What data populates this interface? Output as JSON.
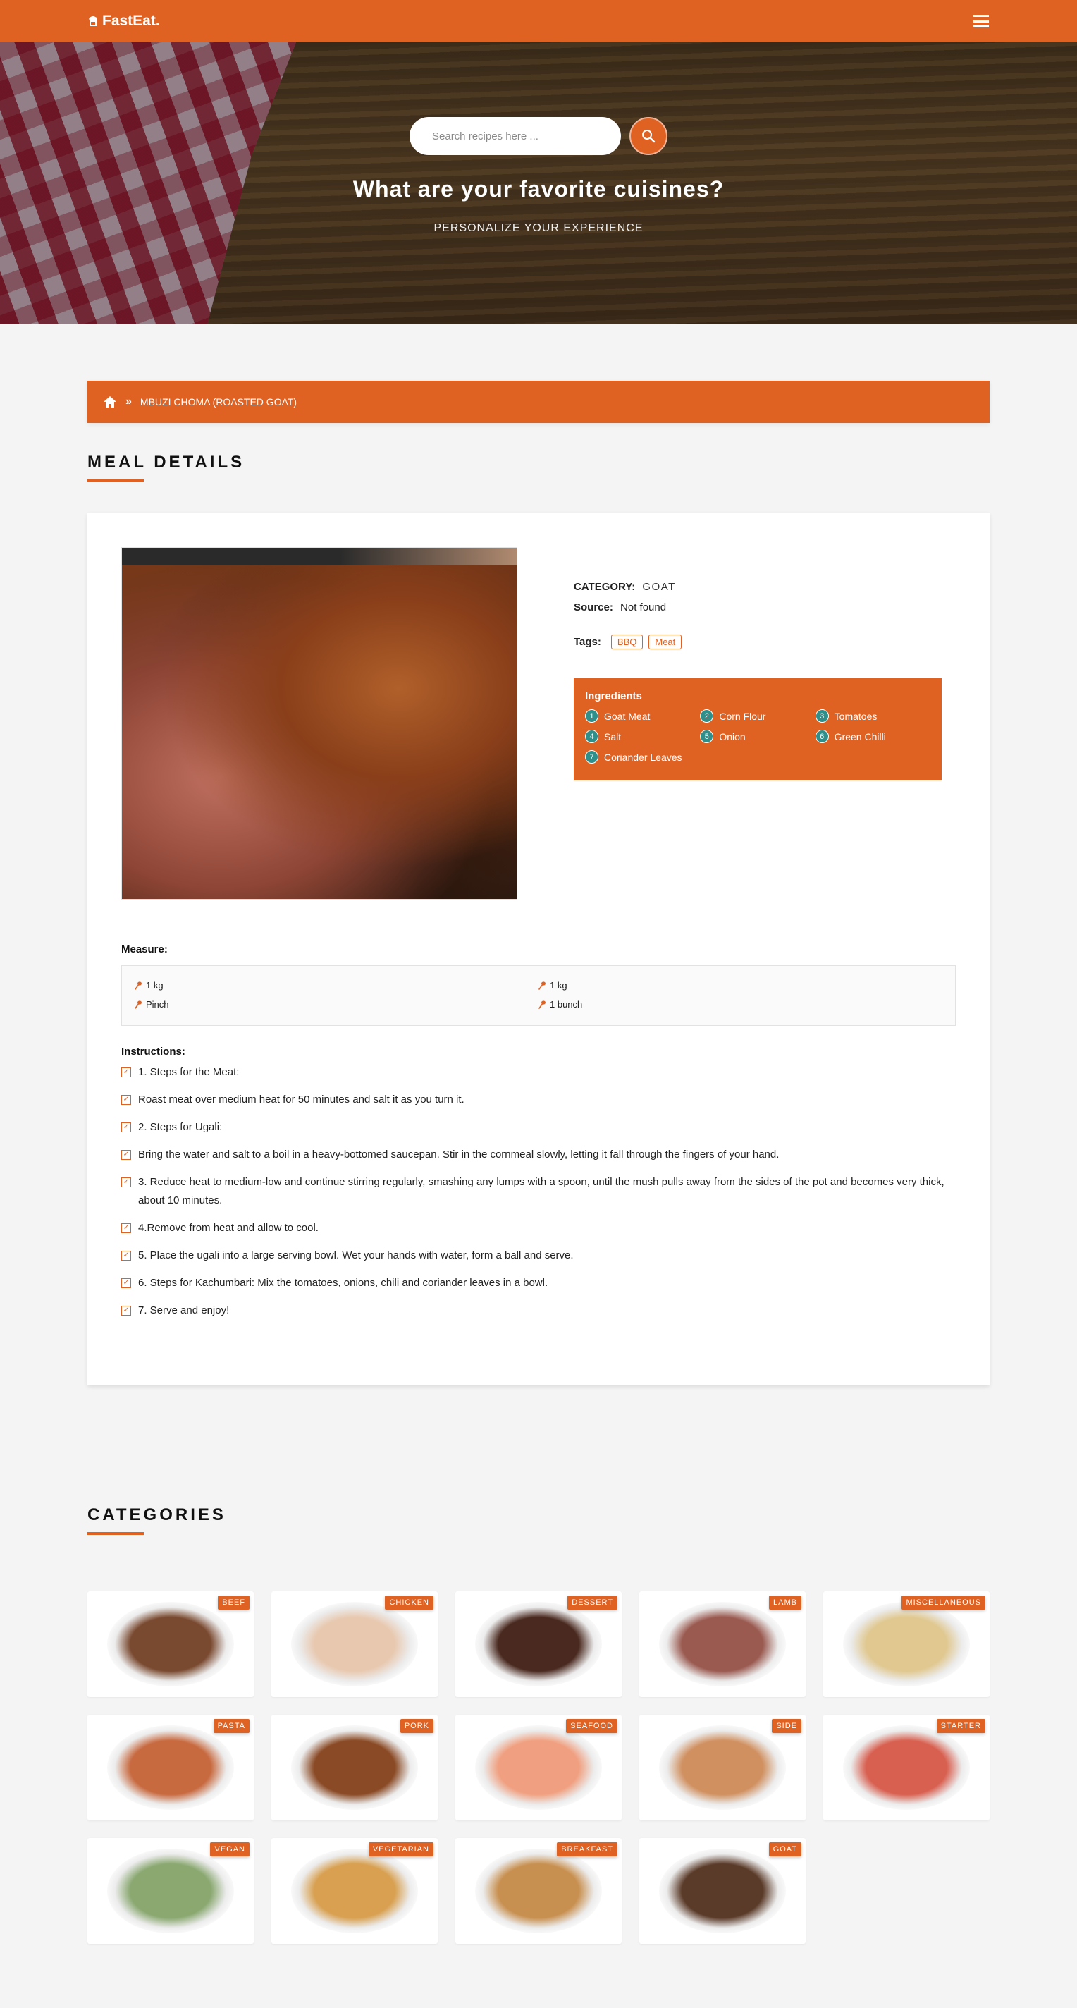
{
  "nav": {
    "brand": "FastEat.",
    "brand_icon": "chef-hat-icon",
    "menu_icon": "hamburger-menu-icon"
  },
  "hero": {
    "search_placeholder": "Search recipes here ...",
    "search_icon": "search-icon",
    "title": "What are your favorite cuisines?",
    "subtitle": "PERSONALIZE YOUR EXPERIENCE"
  },
  "breadcrumb": {
    "home_icon": "home-icon",
    "separator_icon": "double-chevron-right-icon",
    "current": "MBUZI CHOMA (ROASTED GOAT)"
  },
  "meal": {
    "section_title": "MEAL DETAILS",
    "category_label": "CATEGORY:",
    "category_value": "GOAT",
    "source_label": "Source:",
    "source_value": "Not found",
    "tags_label": "Tags:",
    "tags": [
      "BBQ",
      "Meat"
    ],
    "ingredients_title": "Ingredients",
    "ingredients": [
      {
        "n": "1",
        "name": "Goat Meat"
      },
      {
        "n": "2",
        "name": "Corn Flour"
      },
      {
        "n": "3",
        "name": "Tomatoes"
      },
      {
        "n": "4",
        "name": "Salt"
      },
      {
        "n": "5",
        "name": "Onion"
      },
      {
        "n": "6",
        "name": "Green Chilli"
      },
      {
        "n": "7",
        "name": "Coriander Leaves"
      }
    ],
    "measure_label": "Measure:",
    "measures": [
      "1 kg",
      "1 kg",
      "Pinch",
      "1 bunch"
    ],
    "instructions_label": "Instructions:",
    "instructions": [
      "1. Steps for the Meat:",
      "Roast meat over medium heat for 50 minutes and salt it as you turn it.",
      "2. Steps for Ugali:",
      "Bring the water and salt to a boil in a heavy-bottomed saucepan. Stir in the cornmeal slowly, letting it fall through the fingers of your hand.",
      "3. Reduce heat to medium-low and continue stirring regularly, smashing any lumps with a spoon, until the mush pulls away from the sides of the pot and becomes very thick, about 10 minutes.",
      "4.Remove from heat and allow to cool.",
      "5. Place the ugali into a large serving bowl. Wet your hands with water, form a ball and serve.",
      "6. Steps for Kachumbari: Mix the tomatoes, onions, chili and coriander leaves in a bowl.",
      "7. Serve and enjoy!"
    ]
  },
  "categories": {
    "section_title": "CATEGORIES",
    "items": [
      {
        "label": "BEEF",
        "color": "#7a4a30"
      },
      {
        "label": "CHICKEN",
        "color": "#e8c9b0"
      },
      {
        "label": "DESSERT",
        "color": "#4a2a20"
      },
      {
        "label": "LAMB",
        "color": "#9a5a50"
      },
      {
        "label": "MISCELLANEOUS",
        "color": "#e0c890"
      },
      {
        "label": "PASTA",
        "color": "#c86a40"
      },
      {
        "label": "PORK",
        "color": "#8a4a25"
      },
      {
        "label": "SEAFOOD",
        "color": "#f0a080"
      },
      {
        "label": "SIDE",
        "color": "#d09060"
      },
      {
        "label": "STARTER",
        "color": "#d86050"
      },
      {
        "label": "VEGAN",
        "color": "#8aa870"
      },
      {
        "label": "VEGETARIAN",
        "color": "#d8a050"
      },
      {
        "label": "BREAKFAST",
        "color": "#c89050"
      },
      {
        "label": "GOAT",
        "color": "#5a3a28"
      }
    ]
  },
  "colors": {
    "accent": "#e06222",
    "ingredient_number": "#2f8f8a",
    "page_bg": "#f4f4f4"
  }
}
